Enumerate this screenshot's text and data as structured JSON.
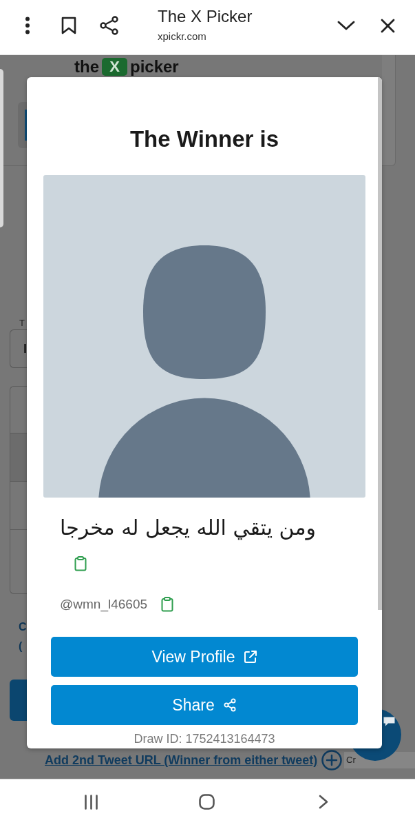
{
  "browser_bar": {
    "title": "The X Picker",
    "url": "xpickr.com"
  },
  "background_page": {
    "logo": {
      "before": "the",
      "mark": "X",
      "after": "picker"
    },
    "field_label": "T",
    "input": {
      "value": "I"
    },
    "texts": [
      "C",
      "("
    ],
    "link": "Add 2nd Tweet URL (Winner from either tweet)",
    "tooltip": "Cr"
  },
  "modal": {
    "title": "The Winner is",
    "winner_name": "ومن يتقي الله يجعل له مخرجا",
    "handle": "@wmn_l46605",
    "buttons": [
      {
        "label": "View Profile",
        "kind": "open"
      },
      {
        "label": "Share",
        "kind": "share"
      }
    ],
    "draw_id": "Draw ID: 1752413164473"
  }
}
